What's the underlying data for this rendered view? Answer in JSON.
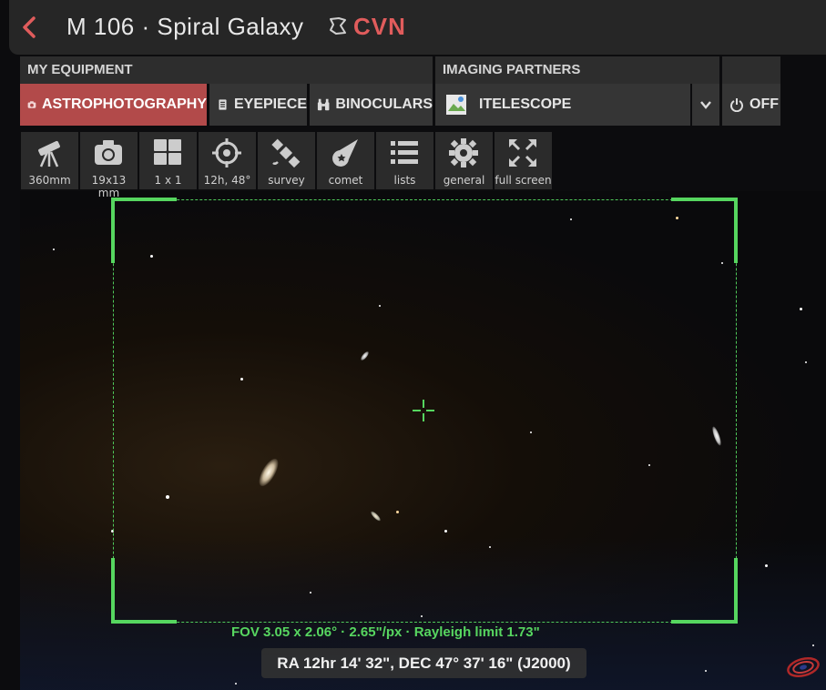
{
  "header": {
    "back_icon": "chevron-left-icon",
    "title": "M 106 · Spiral Galaxy",
    "constellation": "CVN",
    "accent": "#e05c5c"
  },
  "equipment": {
    "my_equipment_label": "MY EQUIPMENT",
    "imaging_partners_label": "IMAGING PARTNERS",
    "tabs": [
      {
        "label": "ASTROPHOTOGRAPHY",
        "icon": "camera-icon",
        "active": true
      },
      {
        "label": "EYEPIECE",
        "icon": "eyepiece-icon",
        "active": false
      },
      {
        "label": "BINOCULARS",
        "icon": "binoculars-icon",
        "active": false
      }
    ],
    "partner": {
      "label": "ITELESCOPE",
      "icon": "broken-image-icon"
    },
    "off_label": "OFF"
  },
  "tools": [
    {
      "label": "360mm",
      "icon": "telescope-icon"
    },
    {
      "label": "19x13 mm",
      "icon": "camera-icon"
    },
    {
      "label": "1 x 1",
      "icon": "grid-icon"
    },
    {
      "label": "12h, 48°",
      "icon": "crosshair-icon"
    },
    {
      "label": "survey",
      "icon": "satellite-icon"
    },
    {
      "label": "comet",
      "icon": "comet-icon"
    },
    {
      "label": "lists",
      "icon": "list-icon"
    },
    {
      "label": "general",
      "icon": "gear-icon"
    },
    {
      "label": "full screen",
      "icon": "fullscreen-icon"
    }
  ],
  "view": {
    "fov_text": "FOV 3.05 x 2.06° · 2.65\"/px · Rayleigh limit 1.73\"",
    "coordinates": "RA 12hr 14' 32\", DEC 47° 37' 16\" (J2000)",
    "frame_color": "#56d65f"
  }
}
